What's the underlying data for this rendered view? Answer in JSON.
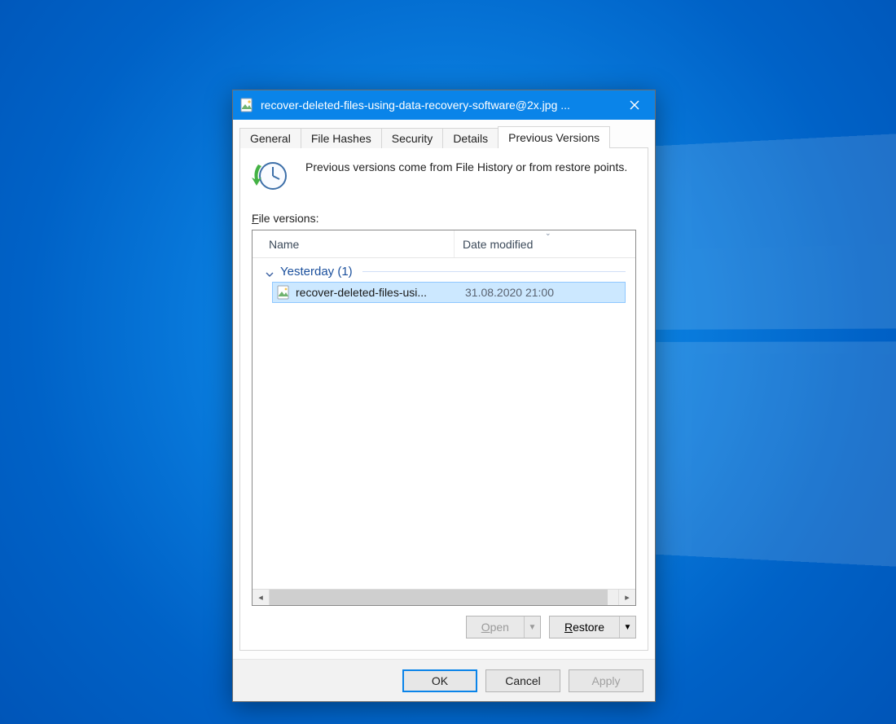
{
  "window": {
    "title": "recover-deleted-files-using-data-recovery-software@2x.jpg ..."
  },
  "tabs": {
    "general": "General",
    "file_hashes": "File Hashes",
    "security": "Security",
    "details": "Details",
    "previous_versions": "Previous Versions"
  },
  "intro_text": "Previous versions come from File History or from restore points.",
  "file_versions_label": "File versions:",
  "columns": {
    "name": "Name",
    "date": "Date modified"
  },
  "group": {
    "label": "Yesterday (1)"
  },
  "items": [
    {
      "name": "recover-deleted-files-usi...",
      "date": "31.08.2020 21:00"
    }
  ],
  "actions": {
    "open": "Open",
    "restore": "Restore"
  },
  "footer": {
    "ok": "OK",
    "cancel": "Cancel",
    "apply": "Apply"
  },
  "icons": {
    "app": "image-file-icon",
    "close": "close-icon",
    "history": "clock-history-icon",
    "chevron_down": "chevron-down-icon",
    "file": "image-file-icon",
    "dropdown": "dropdown-triangle-icon",
    "scroll_left": "scroll-left-icon",
    "scroll_right": "scroll-right-icon"
  },
  "colors": {
    "accent": "#0a84e9",
    "selection": "#cce8ff",
    "group_text": "#1a4f9c"
  }
}
